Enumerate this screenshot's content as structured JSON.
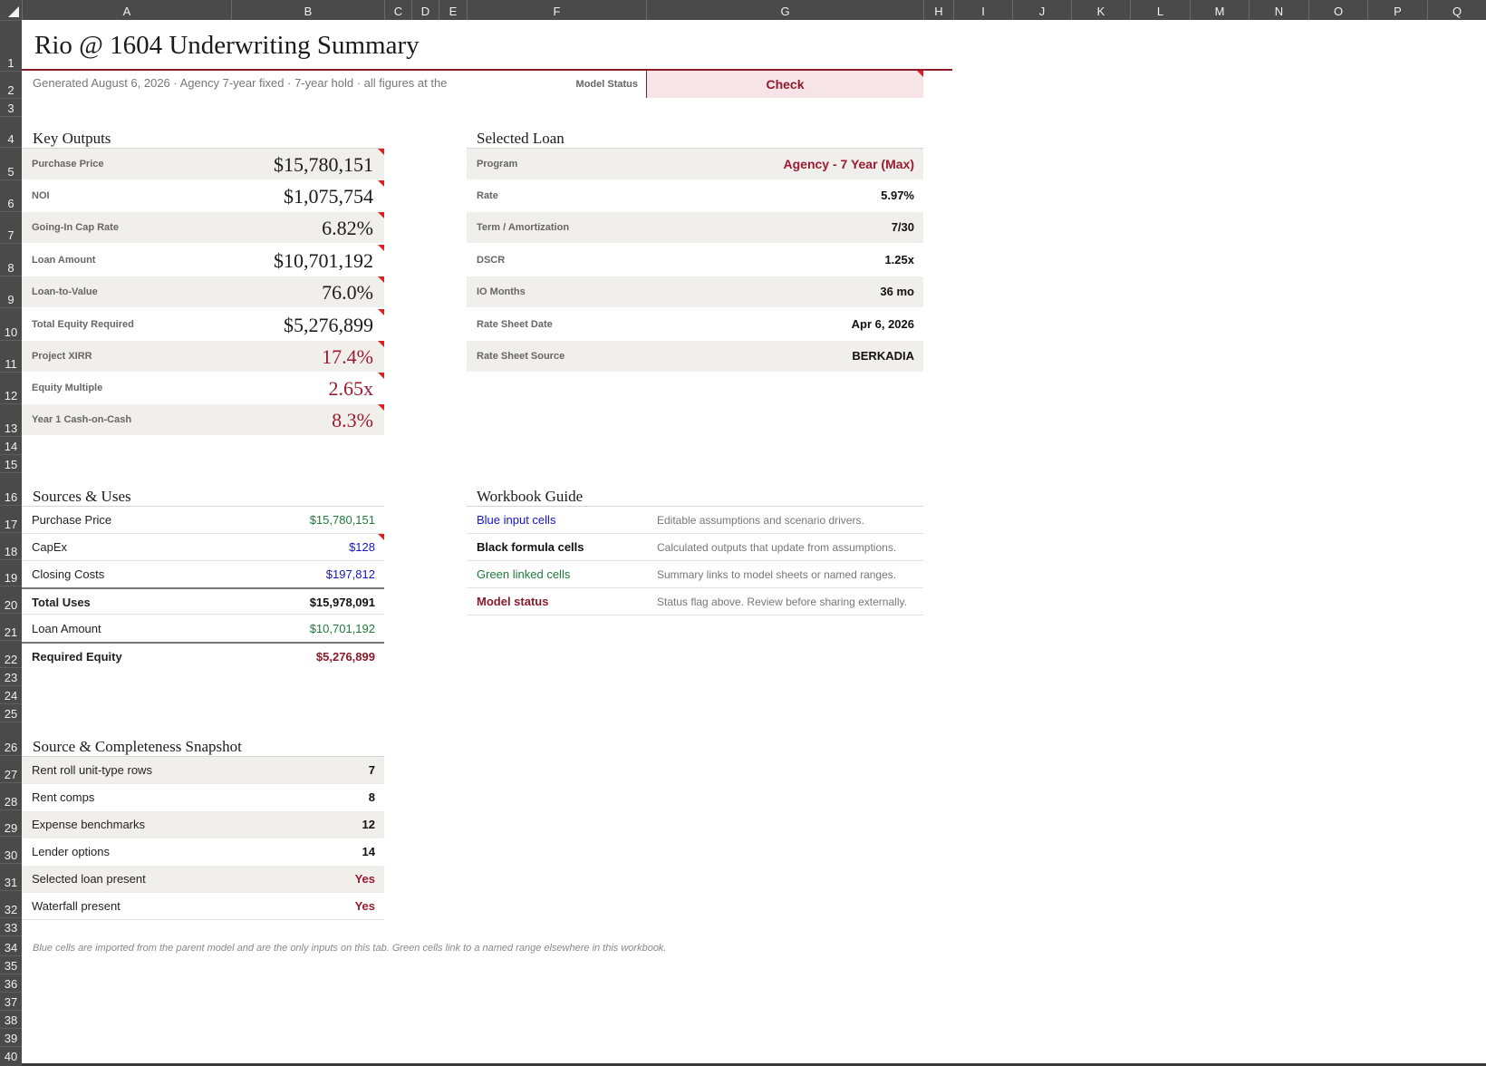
{
  "columns": [
    "A",
    "B",
    "C",
    "D",
    "E",
    "F",
    "G",
    "H",
    "I",
    "J",
    "K",
    "L",
    "M",
    "N",
    "O",
    "P",
    "Q"
  ],
  "rows": [
    "1",
    "2",
    "3",
    "4",
    "5",
    "6",
    "7",
    "8",
    "9",
    "10",
    "11",
    "12",
    "13",
    "14",
    "15",
    "16",
    "17",
    "18",
    "19",
    "20",
    "21",
    "22",
    "23",
    "24",
    "25",
    "26",
    "27",
    "28",
    "29",
    "30",
    "31",
    "32",
    "33",
    "34",
    "35",
    "36",
    "37",
    "38",
    "39",
    "40"
  ],
  "header": {
    "title": "Rio @ 1604 Underwriting Summary",
    "subtitle": "Generated August 6, 2026  ·  Agency 7-year fixed  ·  7-year hold  ·  all figures at the",
    "model_status_label": "Model Status",
    "model_status_value": "Check"
  },
  "key_outputs": {
    "title": "Key Outputs",
    "rows": [
      {
        "label": "Purchase Price",
        "value": "$15,780,151"
      },
      {
        "label": "NOI",
        "value": "$1,075,754"
      },
      {
        "label": "Going-In Cap Rate",
        "value": "6.82%"
      },
      {
        "label": "Loan Amount",
        "value": "$10,701,192"
      },
      {
        "label": "Loan-to-Value",
        "value": "76.0%"
      },
      {
        "label": "Total Equity Required",
        "value": "$5,276,899"
      },
      {
        "label": "Project XIRR",
        "value": "17.4%"
      },
      {
        "label": "Equity Multiple",
        "value": "2.65x"
      },
      {
        "label": "Year 1 Cash-on-Cash",
        "value": "8.3%"
      }
    ]
  },
  "selected_loan": {
    "title": "Selected Loan",
    "rows": [
      {
        "label": "Program",
        "value": "Agency - 7 Year (Max)"
      },
      {
        "label": "Rate",
        "value": "5.97%"
      },
      {
        "label": "Term / Amortization",
        "value": "7/30"
      },
      {
        "label": "DSCR",
        "value": "1.25x"
      },
      {
        "label": "IO Months",
        "value": "36 mo"
      },
      {
        "label": "Rate Sheet Date",
        "value": "Apr 6, 2026"
      },
      {
        "label": "Rate Sheet Source",
        "value": "BERKADIA"
      }
    ]
  },
  "sources_uses": {
    "title": "Sources & Uses",
    "rows": [
      {
        "label": "Purchase Price",
        "value": "$15,780,151"
      },
      {
        "label": "CapEx",
        "value": "$128"
      },
      {
        "label": "Closing Costs",
        "value": "$197,812"
      },
      {
        "label": "Total Uses",
        "value": "$15,978,091"
      },
      {
        "label": "Loan Amount",
        "value": "$10,701,192"
      },
      {
        "label": "Required Equity",
        "value": "$5,276,899"
      }
    ]
  },
  "workbook_guide": {
    "title": "Workbook Guide",
    "rows": [
      {
        "label": "Blue input cells",
        "desc": "Editable assumptions and scenario drivers."
      },
      {
        "label": "Black formula cells",
        "desc": "Calculated outputs that update from assumptions."
      },
      {
        "label": "Green linked cells",
        "desc": "Summary links to model sheets or named ranges."
      },
      {
        "label": "Model status",
        "desc": "Status flag above. Review before sharing externally."
      }
    ]
  },
  "snapshot": {
    "title": "Source & Completeness Snapshot",
    "rows": [
      {
        "label": "Rent roll unit-type rows",
        "value": "7"
      },
      {
        "label": "Rent comps",
        "value": "8"
      },
      {
        "label": "Expense benchmarks",
        "value": "12"
      },
      {
        "label": "Lender options",
        "value": "14"
      },
      {
        "label": "Selected loan present",
        "value": "Yes"
      },
      {
        "label": "Waterfall present",
        "value": "Yes"
      }
    ]
  },
  "footnote": "Blue cells are imported from the parent model and are the only inputs on this tab. Green cells link to a named range elsewhere in this workbook.",
  "colors": {
    "accent": "#8b1a2b",
    "input_blue": "#1414c8",
    "link_green": "#1e7a3a",
    "shade": "#f1efec"
  }
}
